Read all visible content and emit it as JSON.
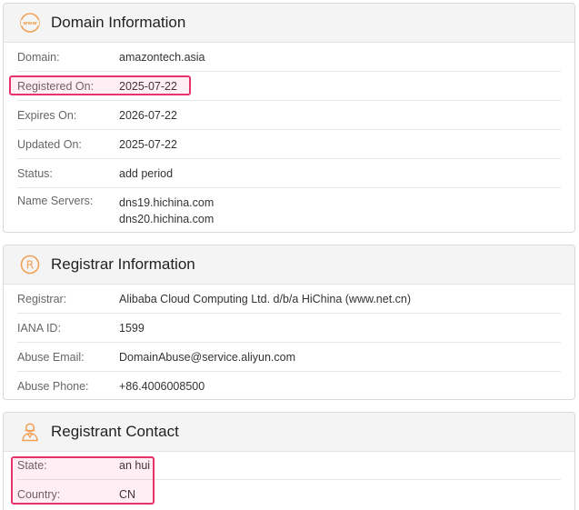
{
  "domain_section": {
    "title": "Domain Information",
    "icon": "www-icon",
    "rows": [
      {
        "label": "Domain:",
        "value": "amazontech.asia"
      },
      {
        "label": "Registered On:",
        "value": "2025-07-22"
      },
      {
        "label": "Expires On:",
        "value": "2026-07-22"
      },
      {
        "label": "Updated On:",
        "value": "2025-07-22"
      },
      {
        "label": "Status:",
        "value": "add period"
      },
      {
        "label": "Name Servers:",
        "value": "dns19.hichina.com",
        "value2": "dns20.hichina.com"
      }
    ]
  },
  "registrar_section": {
    "title": "Registrar Information",
    "icon": "registered-icon",
    "rows": [
      {
        "label": "Registrar:",
        "value": "Alibaba Cloud Computing Ltd. d/b/a HiChina (www.net.cn)"
      },
      {
        "label": "IANA ID:",
        "value": "1599"
      },
      {
        "label": "Abuse Email:",
        "value": "DomainAbuse@service.aliyun.com"
      },
      {
        "label": "Abuse Phone:",
        "value": "+86.4006008500"
      }
    ]
  },
  "registrant_section": {
    "title": "Registrant Contact",
    "icon": "person-icon",
    "rows": [
      {
        "label": "State:",
        "value": "an hui"
      },
      {
        "label": "Country:",
        "value": "CN"
      }
    ]
  },
  "colors": {
    "accent_icon": "#f0a055",
    "highlight": "#e8336a"
  }
}
